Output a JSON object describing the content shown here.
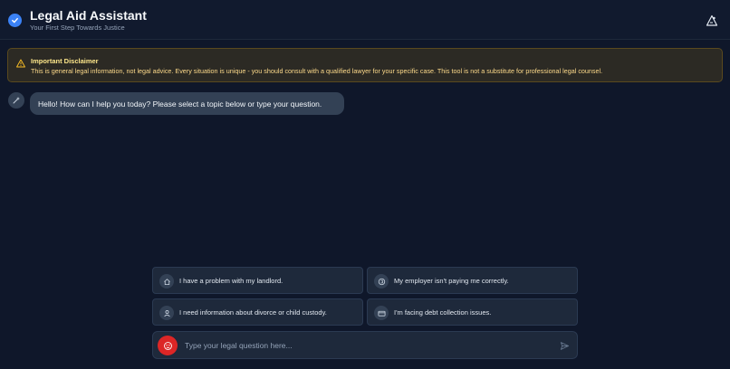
{
  "header": {
    "title": "Legal Aid Assistant",
    "subtitle": "Your First Step Towards Justice",
    "logo_icon": "check-circle-icon",
    "action_icon": "accessibility-icon"
  },
  "disclaimer": {
    "title": "Important Disclaimer",
    "text": "This is general legal information, not legal advice. Every situation is unique - you should consult with a qualified lawyer for your specific case. This tool is not a substitute for professional legal counsel.",
    "icon": "warning-icon"
  },
  "chat": {
    "messages": [
      {
        "sender": "bot",
        "icon": "bot-sparkle-icon",
        "text": "Hello! How can I help you today? Please select a topic below or type your question."
      }
    ]
  },
  "suggestions": [
    {
      "label": "I have a problem with my landlord.",
      "icon": "house-icon"
    },
    {
      "label": "My employer isn't paying me correctly.",
      "icon": "coin-icon"
    },
    {
      "label": "I need information about divorce or child custody.",
      "icon": "person-icon"
    },
    {
      "label": "I'm facing debt collection issues.",
      "icon": "credit-card-icon"
    }
  ],
  "input": {
    "placeholder": "Type your legal question here...",
    "value": "",
    "mic_icon": "microphone-icon",
    "send_icon": "send-icon"
  },
  "colors": {
    "background": "#0f172a",
    "header": "#111a2e",
    "accent": "#3b82f6",
    "bubble": "#334155",
    "warning_bg": "#2c2a24",
    "warning_text": "#fde68a",
    "mic": "#dc2626"
  }
}
